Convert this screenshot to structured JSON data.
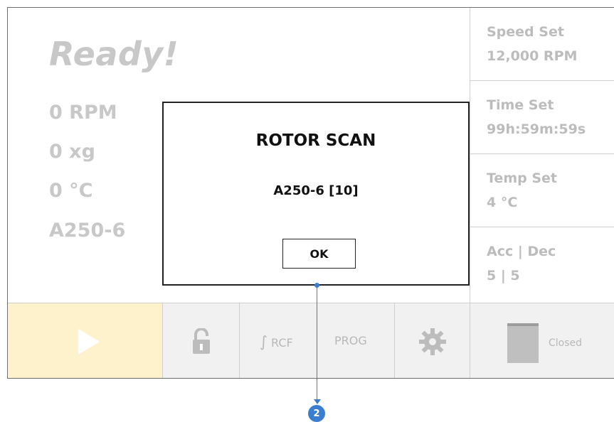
{
  "status": {
    "title": "Ready!"
  },
  "readouts": [
    {
      "value": "0 RPM"
    },
    {
      "value": "0 xg"
    },
    {
      "value": "0 °C"
    },
    {
      "value": "A250-6"
    }
  ],
  "settings": [
    {
      "label": "Speed Set",
      "value": "12,000 RPM"
    },
    {
      "label": "Time Set",
      "value": "99h:59m:59s"
    },
    {
      "label": "Temp Set",
      "value": "4 °C"
    },
    {
      "label": "Acc | Dec",
      "value": "5 | 5"
    }
  ],
  "toolbar": {
    "rcf_label": "RCF",
    "prog_label": "PROG",
    "lid_status": "Closed"
  },
  "dialog": {
    "title": "ROTOR SCAN",
    "rotor": "A250-6 [10]",
    "ok_label": "OK"
  },
  "callout": {
    "number": "2"
  },
  "colors": {
    "play_bg": "#fdf2cc",
    "disabled_text": "#c8c8c8",
    "callout": "#3b7dcf"
  }
}
